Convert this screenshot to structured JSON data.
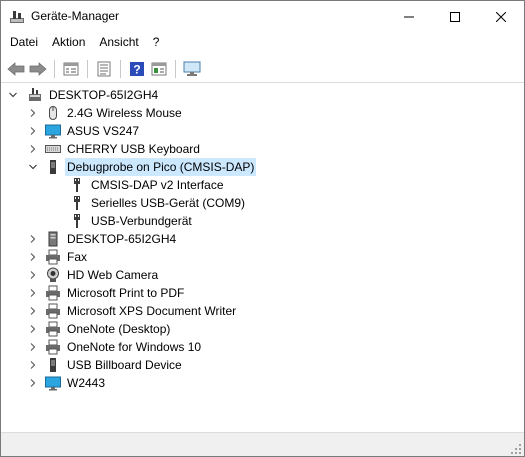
{
  "window": {
    "title": "Geräte-Manager"
  },
  "menu": {
    "items": [
      "Datei",
      "Aktion",
      "Ansicht",
      "?"
    ]
  },
  "toolbar": {
    "buttons": [
      "back-icon",
      "forward-icon",
      "properties-view-icon",
      "list-view-icon",
      "help-icon",
      "properties-icon",
      "monitor-scan-icon"
    ]
  },
  "tree": {
    "root": {
      "label": "DESKTOP-65I2GH4",
      "expanded": true
    },
    "items": [
      {
        "label": "2.4G Wireless Mouse",
        "icon": "mouse-icon",
        "expanded": false
      },
      {
        "label": "ASUS VS247",
        "icon": "monitor-icon",
        "expanded": false
      },
      {
        "label": "CHERRY USB Keyboard",
        "icon": "keyboard-icon",
        "expanded": false
      },
      {
        "label": "Debugprobe on Pico (CMSIS-DAP)",
        "icon": "device-icon",
        "expanded": true,
        "selected": true,
        "children": [
          {
            "label": "CMSIS-DAP v2 Interface",
            "icon": "usb-icon"
          },
          {
            "label": "Serielles USB-Gerät (COM9)",
            "icon": "usb-icon"
          },
          {
            "label": "USB-Verbundgerät",
            "icon": "usb-icon"
          }
        ]
      },
      {
        "label": "DESKTOP-65I2GH4",
        "icon": "computer-icon",
        "expanded": false
      },
      {
        "label": "Fax",
        "icon": "printer-icon",
        "expanded": false
      },
      {
        "label": "HD Web Camera",
        "icon": "webcam-icon",
        "expanded": false
      },
      {
        "label": "Microsoft Print to PDF",
        "icon": "printer-icon",
        "expanded": false
      },
      {
        "label": "Microsoft XPS Document Writer",
        "icon": "printer-icon",
        "expanded": false
      },
      {
        "label": "OneNote (Desktop)",
        "icon": "printer-icon",
        "expanded": false
      },
      {
        "label": "OneNote for Windows 10",
        "icon": "printer-icon",
        "expanded": false
      },
      {
        "label": "USB Billboard Device",
        "icon": "device-icon",
        "expanded": false
      },
      {
        "label": "W2443",
        "icon": "monitor-icon",
        "expanded": false
      }
    ]
  },
  "colors": {
    "selection": "#cce8ff",
    "accent": "#0078d7"
  }
}
